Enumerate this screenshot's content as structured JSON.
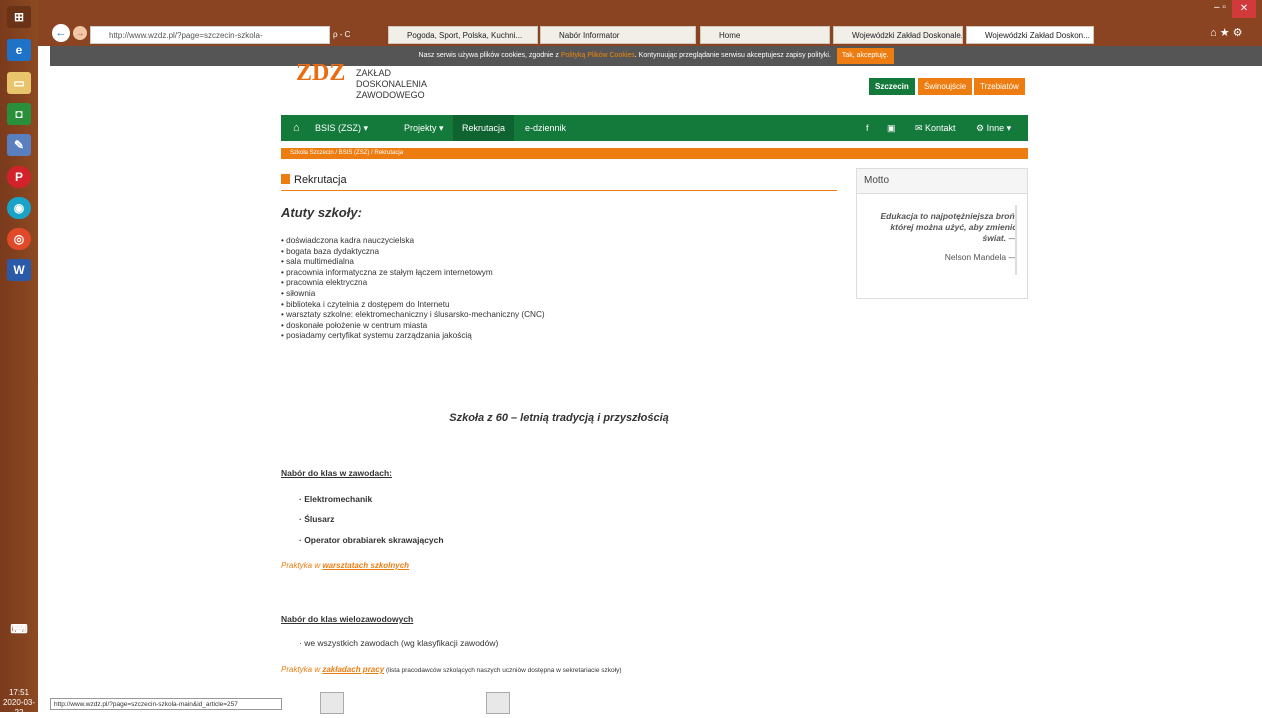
{
  "browser": {
    "url": "http://www.wzdz.pl/?page=szczecin-szkola-main&id_article=257",
    "search_placeholder": "ρ - C",
    "tabs": [
      "Pogoda, Sport, Polska, Kuchni...",
      "Nabór Informator",
      "Home",
      "Wojewódzki Zakład Doskonale...",
      "Wojewódzki Zakład Doskon..."
    ]
  },
  "cookie": {
    "text": "Nasz serwis używa plików cookies, zgodnie z",
    "link": "Polityką Plików Cookies",
    "text2": ". Kontynuując przeglądanie serwisu akceptujesz zapisy polityki.",
    "button": "Tak, akceptuję."
  },
  "site": {
    "logo_mark": "ZDZ",
    "logo_lines": [
      "ZAKŁAD",
      "DOSKONALENIA",
      "ZAWODOWEGO"
    ],
    "cities": [
      "Szczecin",
      "Świnoujście",
      "Trzebiatów"
    ],
    "nav": {
      "home": "⌂",
      "bsis": "BSIS (ZSZ) ▾",
      "projekty": "Projekty ▾",
      "rekrutacja": "Rekrutacja",
      "edziennik": "e-dziennik",
      "fb": "f",
      "yt": "▣",
      "kontakt": "✉ Kontakt",
      "inne": "⚙ Inne ▾"
    },
    "breadcrumb": "Szkoła Szczecin  /  BSIS (ZSZ)  /  Rekrutacja"
  },
  "content": {
    "heading": "Rekrutacja",
    "atuty": "Atuty szkoły:",
    "list": [
      "• doświadczona kadra nauczycielska",
      "• bogata baza dydaktyczna",
      "• sala multimedialna",
      "• pracownia informatyczna ze stałym łączem internetowym",
      "• pracownia elektryczna",
      "• siłownia",
      "• biblioteka i czytelnia z dostępem do Internetu",
      "• warsztaty szkolne: elektromechaniczny i ślusarsko-mechaniczny (CNC)",
      "• doskonałe położenie w centrum miasta",
      "• posiadamy certyfikat systemu zarządzania jakością"
    ],
    "tagline": "Szkoła z 60 – letnią tradycją i przyszłością",
    "nabor1": "Nabór do klas w zawodach:",
    "zawody": [
      "·  Elektromechanik",
      "·  Ślusarz",
      "·  Operator obrabiarek skrawających"
    ],
    "praktyka1_pre": "Praktyka w ",
    "praktyka1_link": "warsztatach szkolnych",
    "nabor2": "Nabór do klas wielozawodowych",
    "wszystkie": "·  we wszystkich zawodach (wg klasyfikacji zawodów)",
    "praktyka2_pre": "Praktyka w ",
    "praktyka2_link": "zakładach pracy",
    "praktyka2_post": " (lista pracodawców szkolących naszych uczniów dostępna w sekretariacie szkoły)"
  },
  "motto": {
    "title": "Motto",
    "quote": "Edukacja to najpotężniejsza broń, której można użyć, aby zmienić świat.",
    "dash": " —",
    "author": "Nelson Mandela —"
  },
  "taskbar": {
    "time": "17:51",
    "date": "2020-03-22"
  },
  "status_url": "http://www.wzdz.pl/?page=szczecin-szkola-main&id_article=257"
}
